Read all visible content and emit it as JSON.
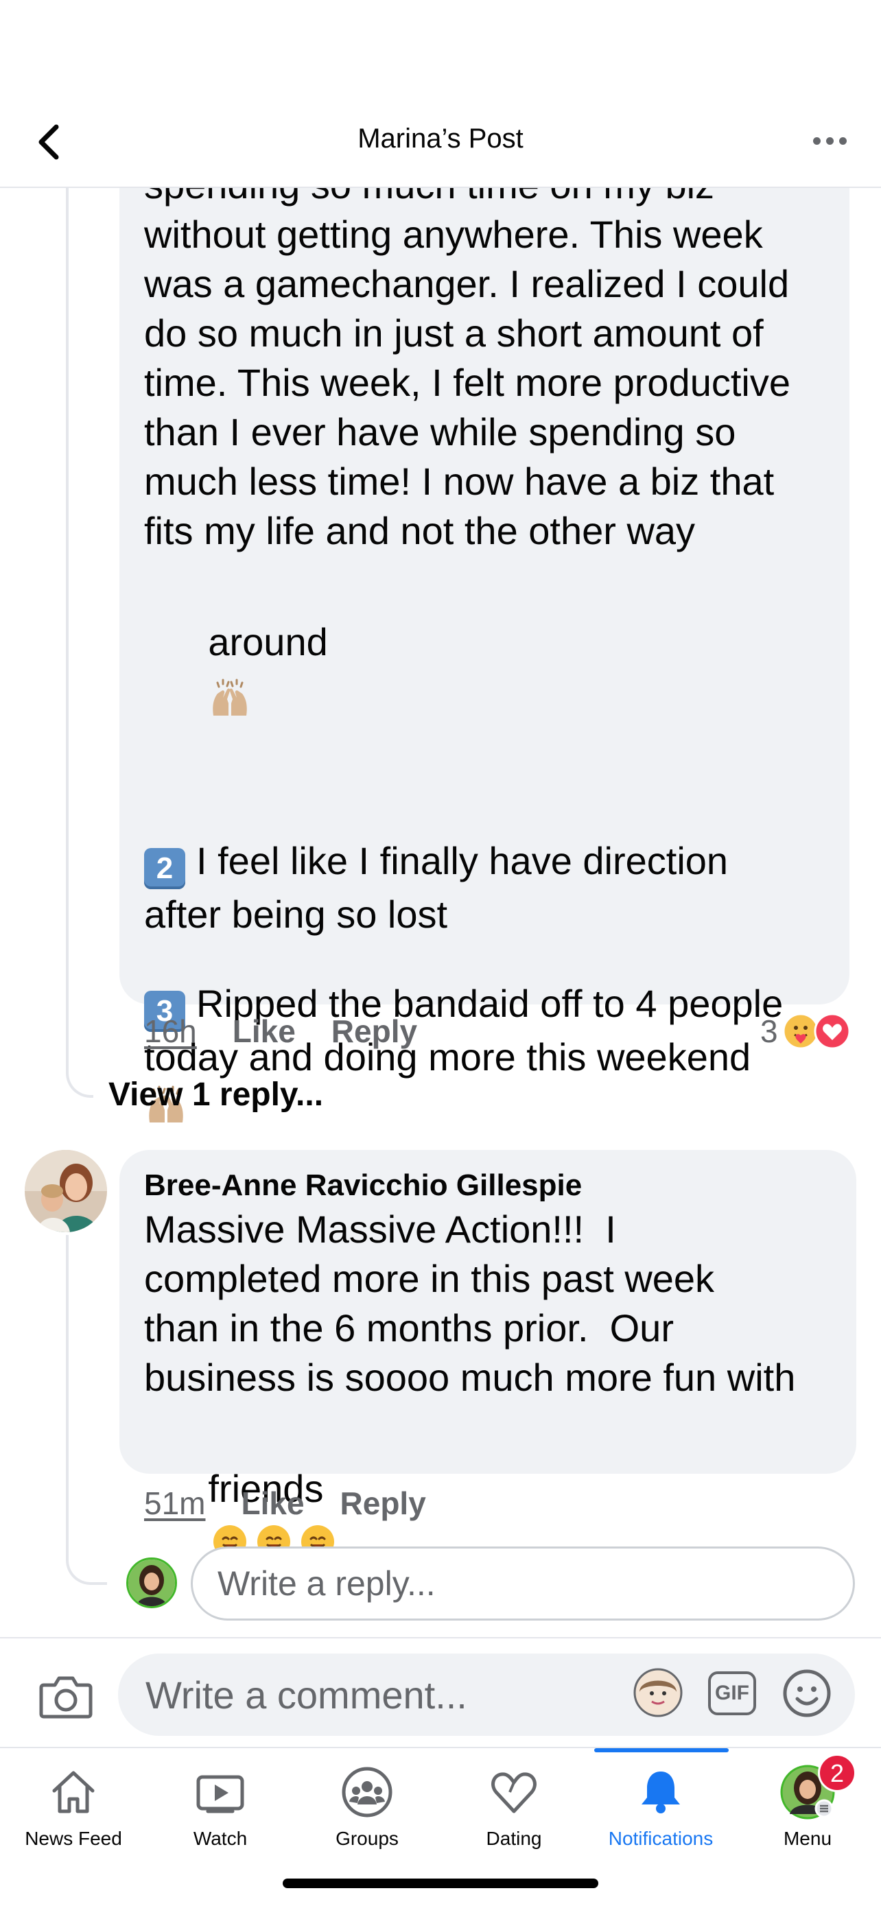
{
  "header": {
    "title": "Marina’s Post"
  },
  "comment1": {
    "cut_top_text": "spending so much time on my biz",
    "text_lines_a": "without getting anywhere. This week\nwas a gamechanger. I realized I could\ndo so much in just a short amount of\ntime. This week, I felt more productive\nthan I ever have while spending so\nmuch less time! I now have a biz that\nfits my life and not the other way",
    "text_around": "around",
    "item2_number": "2",
    "item2_text": "I feel like I finally have direction\nafter being so lost",
    "item3_number": "3",
    "item3_text": "Ripped the bandaid off to 4 people\ntoday and doing more this weekend",
    "time": "16h",
    "like_label": "Like",
    "reply_label": "Reply",
    "reaction_count": "3"
  },
  "view_replies_label": "View 1 reply...",
  "comment2": {
    "author": "Bree-Anne Ravicchio Gillespie",
    "text": "Massive Massive Action!!!  I\ncompleted more in this past week\nthan in the 6 months prior.  Our\nbusiness is soooo much more fun with",
    "text_last": "friends",
    "time": "51m",
    "like_label": "Like",
    "reply_label": "Reply"
  },
  "reply_box": {
    "placeholder": "Write a reply..."
  },
  "composer": {
    "placeholder": "Write a comment...",
    "gif_label": "GIF"
  },
  "bottom_nav": {
    "items": [
      {
        "label": "News Feed",
        "icon": "home-icon"
      },
      {
        "label": "Watch",
        "icon": "watch-icon"
      },
      {
        "label": "Groups",
        "icon": "groups-icon"
      },
      {
        "label": "Dating",
        "icon": "dating-heart-icon"
      },
      {
        "label": "Notifications",
        "icon": "bell-icon",
        "active": true
      },
      {
        "label": "Menu",
        "icon": "profile-avatar"
      }
    ],
    "menu_badge": "2"
  },
  "colors": {
    "accent": "#1877f2",
    "bubble": "#f0f2f5",
    "secondary_text": "#65676b",
    "badge": "#e41e3f"
  }
}
